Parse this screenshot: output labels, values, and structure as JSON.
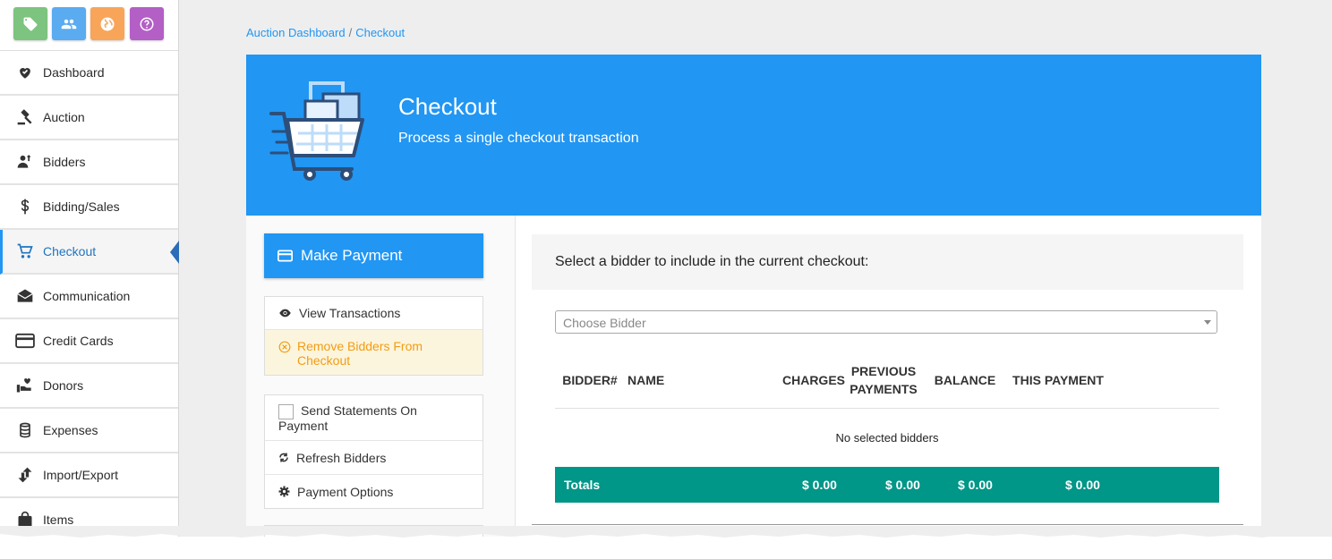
{
  "colors": {
    "primary": "#2196f3",
    "tag_tile": "#7cc47f",
    "people_tile": "#5aabf0",
    "globe_tile": "#f8a55a",
    "help_tile": "#b35fc5",
    "totals_bar": "#009688",
    "warning_text": "#f39c12"
  },
  "top_icons": [
    {
      "name": "tag-icon"
    },
    {
      "name": "people-icon"
    },
    {
      "name": "globe-icon"
    },
    {
      "name": "help-icon"
    }
  ],
  "sidebar": {
    "items": [
      {
        "label": "Dashboard",
        "icon": "heart-hand-icon"
      },
      {
        "label": "Auction",
        "icon": "gavel-icon"
      },
      {
        "label": "Bidders",
        "icon": "bidder-icon"
      },
      {
        "label": "Bidding/Sales",
        "icon": "dollar-icon"
      },
      {
        "label": "Checkout",
        "icon": "cart-icon",
        "active": true
      },
      {
        "label": "Communication",
        "icon": "envelope-icon"
      },
      {
        "label": "Credit Cards",
        "icon": "credit-card-icon"
      },
      {
        "label": "Donors",
        "icon": "donor-icon"
      },
      {
        "label": "Expenses",
        "icon": "coins-icon"
      },
      {
        "label": "Import/Export",
        "icon": "import-export-icon"
      },
      {
        "label": "Items",
        "icon": "bag-icon"
      }
    ]
  },
  "breadcrumb": {
    "parent": "Auction Dashboard",
    "separator": "/",
    "current": "Checkout"
  },
  "hero": {
    "title": "Checkout",
    "subtitle": "Process a single checkout transaction"
  },
  "actions": {
    "make_payment": "Make Payment",
    "view_transactions": "View Transactions",
    "remove_bidders": "Remove Bidders From Checkout",
    "send_statements": "Send Statements On Payment",
    "refresh_bidders": "Refresh Bidders",
    "payment_options": "Payment Options"
  },
  "checkout": {
    "heading": "Select a bidder to include in the current checkout:",
    "select_placeholder": "Choose Bidder",
    "columns": [
      "BIDDER#",
      "NAME",
      "CHARGES",
      "PREVIOUS PAYMENTS",
      "BALANCE",
      "THIS PAYMENT"
    ],
    "empty_message": "No selected bidders",
    "totals": {
      "label": "Totals",
      "charges": "$ 0.00",
      "previous": "$ 0.00",
      "balance": "$ 0.00",
      "this_payment": "$ 0.00"
    }
  }
}
